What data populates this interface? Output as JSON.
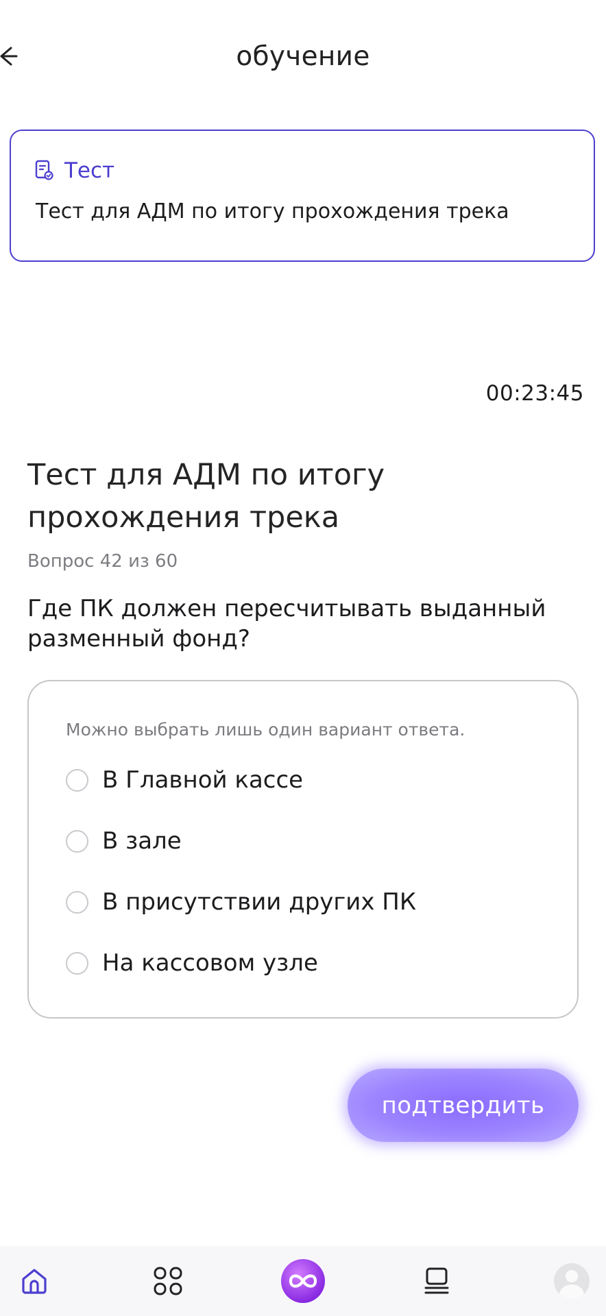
{
  "header": {
    "title": "обучение"
  },
  "card": {
    "type_label": "Тест",
    "description": "Тест для АДМ по итогу прохождения трека"
  },
  "timer": "00:23:45",
  "test": {
    "title": "Тест для АДМ по итогу прохождения трека",
    "counter": "Вопрос 42 из 60",
    "question": "Где ПК должен пересчитывать выданный разменный фонд?",
    "hint": "Можно выбрать лишь один вариант ответа.",
    "options": [
      {
        "label": "В Главной кассе"
      },
      {
        "label": "В зале"
      },
      {
        "label": "В присутствии других ПК"
      },
      {
        "label": "На кассовом узле"
      }
    ]
  },
  "actions": {
    "confirm_label": "подтвердить"
  },
  "tabbar": {
    "items": [
      {
        "icon": "home-icon",
        "active": true
      },
      {
        "icon": "grid-icon",
        "active": false
      },
      {
        "icon": "infinity-icon",
        "active": false
      },
      {
        "icon": "list-icon",
        "active": false
      },
      {
        "icon": "avatar-icon",
        "active": false
      }
    ]
  },
  "colors": {
    "accent": "#4c3ed0",
    "button": "#8a6cff",
    "muted_text": "#7d7d82",
    "border": "#c6c6cb"
  }
}
